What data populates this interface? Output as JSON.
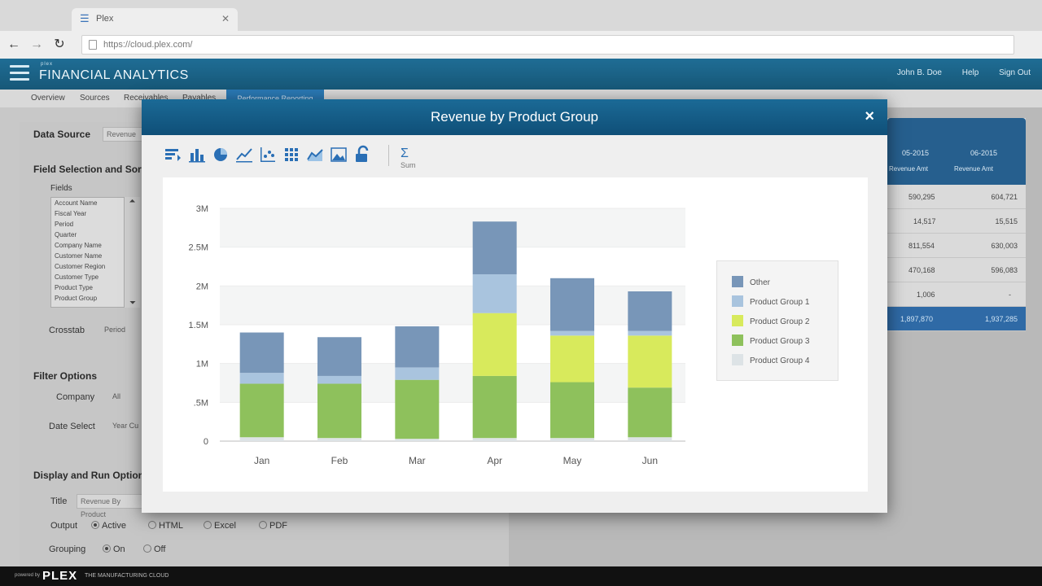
{
  "browser": {
    "tab_title": "Plex",
    "url": "https://cloud.plex.com/"
  },
  "app": {
    "small_label": "plex",
    "title": "FINANCIAL ANALYTICS",
    "user": "John B. Doe",
    "help": "Help",
    "signout": "Sign Out"
  },
  "subnav": {
    "items": [
      "Overview",
      "Sources",
      "Receivables",
      "Payables"
    ],
    "active": "Performance Reporting"
  },
  "left": {
    "data_source_label": "Data Source",
    "data_source_value": "Revenue",
    "field_selection_label": "Field Selection and Sort",
    "fields_label": "Fields",
    "fields": [
      "Account Name",
      "Fiscal Year",
      "Period",
      "Quarter",
      "Company Name",
      "Customer Name",
      "Customer Region",
      "Customer Type",
      "Product Type",
      "Product Group"
    ],
    "crosstab_label": "Crosstab",
    "crosstab_value": "Period",
    "filter_options_label": "Filter Options",
    "company_label": "Company",
    "company_value": "All",
    "date_select_label": "Date Select",
    "date_select_value": "Year Cu",
    "display_label": "Display and Run Options",
    "title_label": "Title",
    "title_value": "Revenue By Product",
    "output_label": "Output",
    "output_options": [
      "Active",
      "HTML",
      "Excel",
      "PDF"
    ],
    "grouping_label": "Grouping",
    "grouping_options": [
      "On",
      "Off"
    ]
  },
  "bg_table": {
    "col1": "05-2015",
    "col2": "06-2015",
    "sub1": "Revenue Amt",
    "sub2": "Revenue Amt",
    "rows": [
      [
        "590,295",
        "604,721"
      ],
      [
        "14,517",
        "15,515"
      ],
      [
        "811,554",
        "630,003"
      ],
      [
        "470,168",
        "596,083"
      ],
      [
        "1,006",
        "-"
      ]
    ],
    "total": [
      "1,897,870",
      "1,937,285"
    ]
  },
  "modal": {
    "title": "Revenue by Product Group",
    "close": "×",
    "sum_label": "Sum",
    "tools": [
      "sort-icon",
      "bar-chart-icon",
      "pie-chart-icon",
      "line-chart-icon",
      "scatter-chart-icon",
      "grid-icon",
      "area-chart-icon",
      "image-chart-icon",
      "lock-icon"
    ]
  },
  "chart_data": {
    "type": "bar",
    "stacked": true,
    "categories": [
      "Jan",
      "Feb",
      "Mar",
      "Apr",
      "May",
      "Jun"
    ],
    "ylim": [
      0,
      3000000
    ],
    "ytick_labels": [
      "0",
      ".5M",
      "1M",
      "1.5M",
      "2M",
      "2.5M",
      "3M"
    ],
    "ytick_values": [
      0,
      500000,
      1000000,
      1500000,
      2000000,
      2500000,
      3000000
    ],
    "series": [
      {
        "name": "Product Group 4",
        "color": "#dde3e6",
        "values": [
          50000,
          40000,
          30000,
          40000,
          40000,
          50000
        ]
      },
      {
        "name": "Product Group 3",
        "color": "#8ec15c",
        "values": [
          690000,
          700000,
          760000,
          800000,
          720000,
          640000
        ]
      },
      {
        "name": "Product Group 2",
        "color": "#d8ea5c",
        "values": [
          0,
          0,
          0,
          810000,
          600000,
          670000
        ]
      },
      {
        "name": "Product Group 1",
        "color": "#a9c4de",
        "values": [
          140000,
          100000,
          160000,
          500000,
          60000,
          60000
        ]
      },
      {
        "name": "Other",
        "color": "#7896b8",
        "values": [
          520000,
          500000,
          530000,
          680000,
          680000,
          510000
        ]
      }
    ],
    "legend_order": [
      "Other",
      "Product Group 1",
      "Product Group 2",
      "Product Group 3",
      "Product Group 4"
    ],
    "legend_position": "right"
  }
}
